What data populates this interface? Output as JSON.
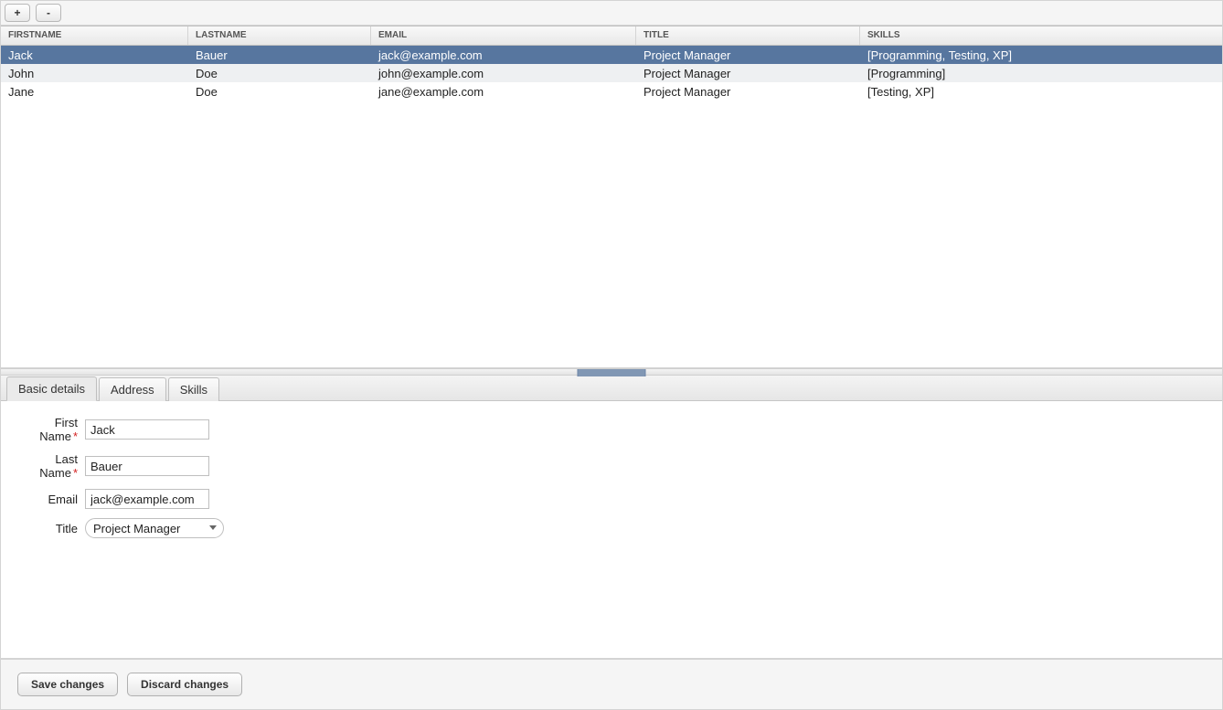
{
  "toolbar": {
    "add_label": "+",
    "remove_label": "-"
  },
  "table": {
    "columns": [
      "FirstName",
      "LastName",
      "Email",
      "Title",
      "Skills"
    ],
    "selected_index": 0,
    "rows": [
      {
        "firstname": "Jack",
        "lastname": "Bauer",
        "email": "jack@example.com",
        "title": "Project Manager",
        "skills": "[Programming, Testing, XP]"
      },
      {
        "firstname": "John",
        "lastname": "Doe",
        "email": "john@example.com",
        "title": "Project Manager",
        "skills": "[Programming]"
      },
      {
        "firstname": "Jane",
        "lastname": "Doe",
        "email": "jane@example.com",
        "title": "Project Manager",
        "skills": "[Testing, XP]"
      }
    ]
  },
  "tabs": {
    "items": [
      {
        "label": "Basic details"
      },
      {
        "label": "Address"
      },
      {
        "label": "Skills"
      }
    ],
    "active_index": 0
  },
  "form": {
    "first_name": {
      "label": "First Name",
      "value": "Jack",
      "required": true
    },
    "last_name": {
      "label": "Last Name",
      "value": "Bauer",
      "required": true
    },
    "email": {
      "label": "Email",
      "value": "jack@example.com",
      "required": false
    },
    "title": {
      "label": "Title",
      "value": "Project Manager",
      "required": false
    }
  },
  "footer": {
    "save_label": "Save changes",
    "discard_label": "Discard changes"
  },
  "colors": {
    "selection": "#57769f",
    "required": "#d42020"
  }
}
